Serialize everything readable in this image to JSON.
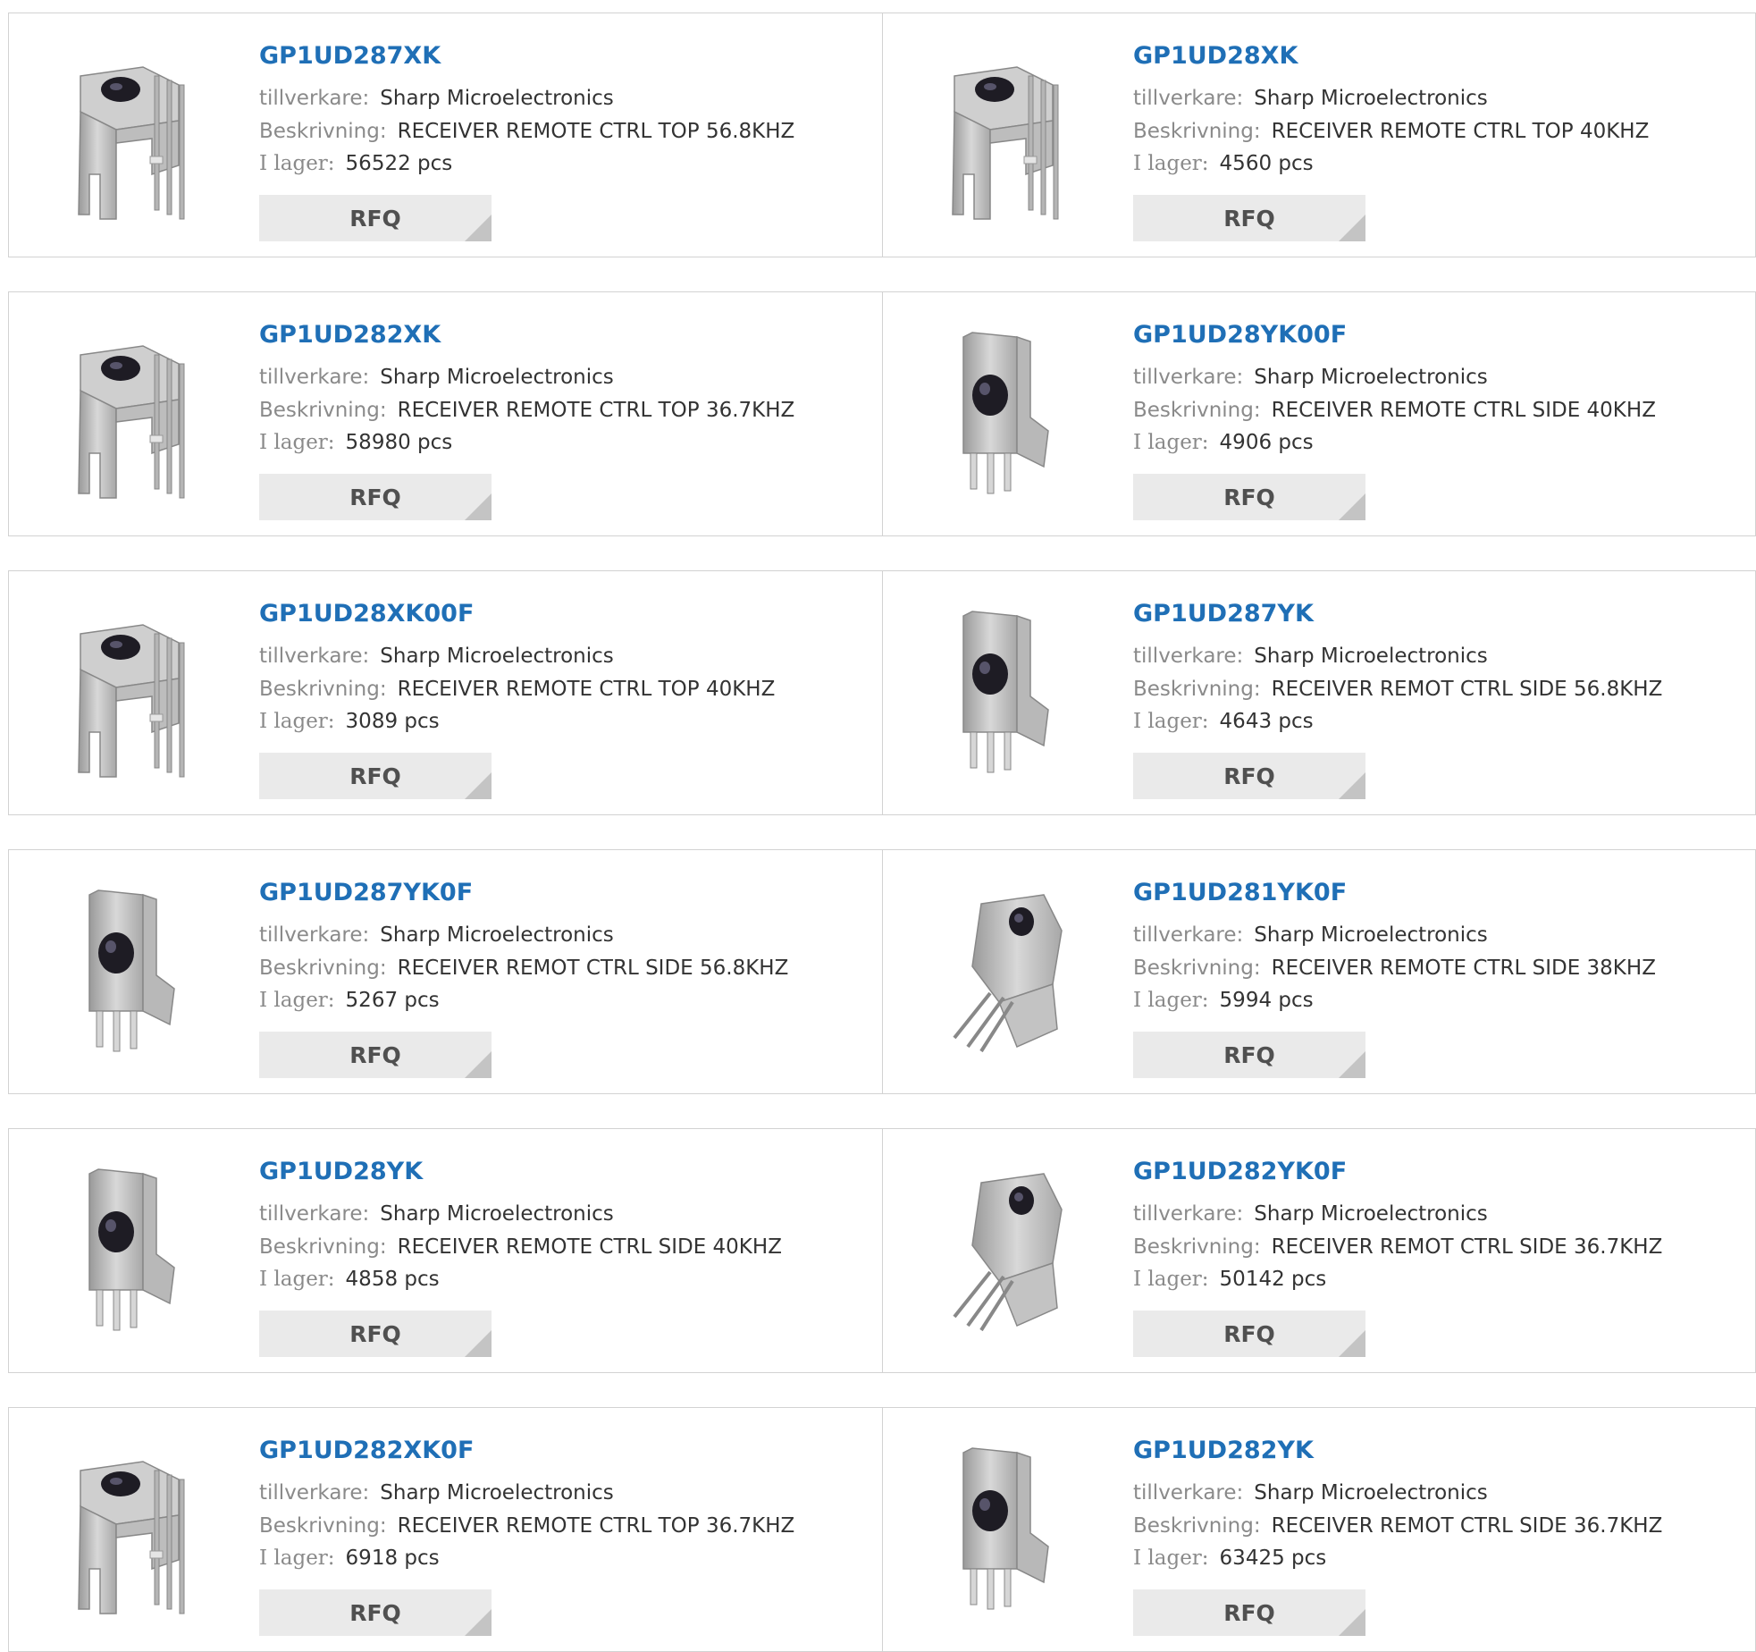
{
  "labels": {
    "manufacturer": "tillverkare:",
    "description": "Beskrivning:",
    "stock": "I lager:",
    "rfq": "RFQ"
  },
  "products": [
    {
      "part": "GP1UD287XK",
      "manufacturer": "Sharp Microelectronics",
      "description": "RECEIVER REMOTE CTRL TOP 56.8KHZ",
      "stock": "56522 pcs",
      "image": "top-view-receiver"
    },
    {
      "part": "GP1UD28XK",
      "manufacturer": "Sharp Microelectronics",
      "description": "RECEIVER REMOTE CTRL TOP 40KHZ",
      "stock": "4560 pcs",
      "image": "top-view-receiver"
    },
    {
      "part": "GP1UD282XK",
      "manufacturer": "Sharp Microelectronics",
      "description": "RECEIVER REMOTE CTRL TOP 36.7KHZ",
      "stock": "58980 pcs",
      "image": "top-view-receiver"
    },
    {
      "part": "GP1UD28YK00F",
      "manufacturer": "Sharp Microelectronics",
      "description": "RECEIVER REMOTE CTRL SIDE 40KHZ",
      "stock": "4906 pcs",
      "image": "side-view-receiver"
    },
    {
      "part": "GP1UD28XK00F",
      "manufacturer": "Sharp Microelectronics",
      "description": "RECEIVER REMOTE CTRL TOP 40KHZ",
      "stock": "3089 pcs",
      "image": "top-view-receiver"
    },
    {
      "part": "GP1UD287YK",
      "manufacturer": "Sharp Microelectronics",
      "description": "RECEIVER REMOT CTRL SIDE 56.8KHZ",
      "stock": "4643 pcs",
      "image": "side-view-receiver"
    },
    {
      "part": "GP1UD287YK0F",
      "manufacturer": "Sharp Microelectronics",
      "description": "RECEIVER REMOT CTRL SIDE 56.8KHZ",
      "stock": "5267 pcs",
      "image": "side-view-receiver"
    },
    {
      "part": "GP1UD281YK0F",
      "manufacturer": "Sharp Microelectronics",
      "description": "RECEIVER REMOTE CTRL SIDE 38KHZ",
      "stock": "5994 pcs",
      "image": "angled-receiver"
    },
    {
      "part": "GP1UD28YK",
      "manufacturer": "Sharp Microelectronics",
      "description": "RECEIVER REMOTE CTRL SIDE 40KHZ",
      "stock": "4858 pcs",
      "image": "side-view-receiver"
    },
    {
      "part": "GP1UD282YK0F",
      "manufacturer": "Sharp Microelectronics",
      "description": "RECEIVER REMOT CTRL SIDE 36.7KHZ",
      "stock": "50142 pcs",
      "image": "angled-receiver"
    },
    {
      "part": "GP1UD282XK0F",
      "manufacturer": "Sharp Microelectronics",
      "description": "RECEIVER REMOTE CTRL TOP 36.7KHZ",
      "stock": "6918 pcs",
      "image": "top-view-receiver"
    },
    {
      "part": "GP1UD282YK",
      "manufacturer": "Sharp Microelectronics",
      "description": "RECEIVER REMOT CTRL SIDE 36.7KHZ",
      "stock": "63425 pcs",
      "image": "side-view-receiver"
    }
  ],
  "colors": {
    "link": "#1f6fb6",
    "label": "#8a8a8a",
    "value": "#333333",
    "button_bg": "#eaeaea",
    "button_text": "#505050",
    "border": "#d2d2d2"
  }
}
